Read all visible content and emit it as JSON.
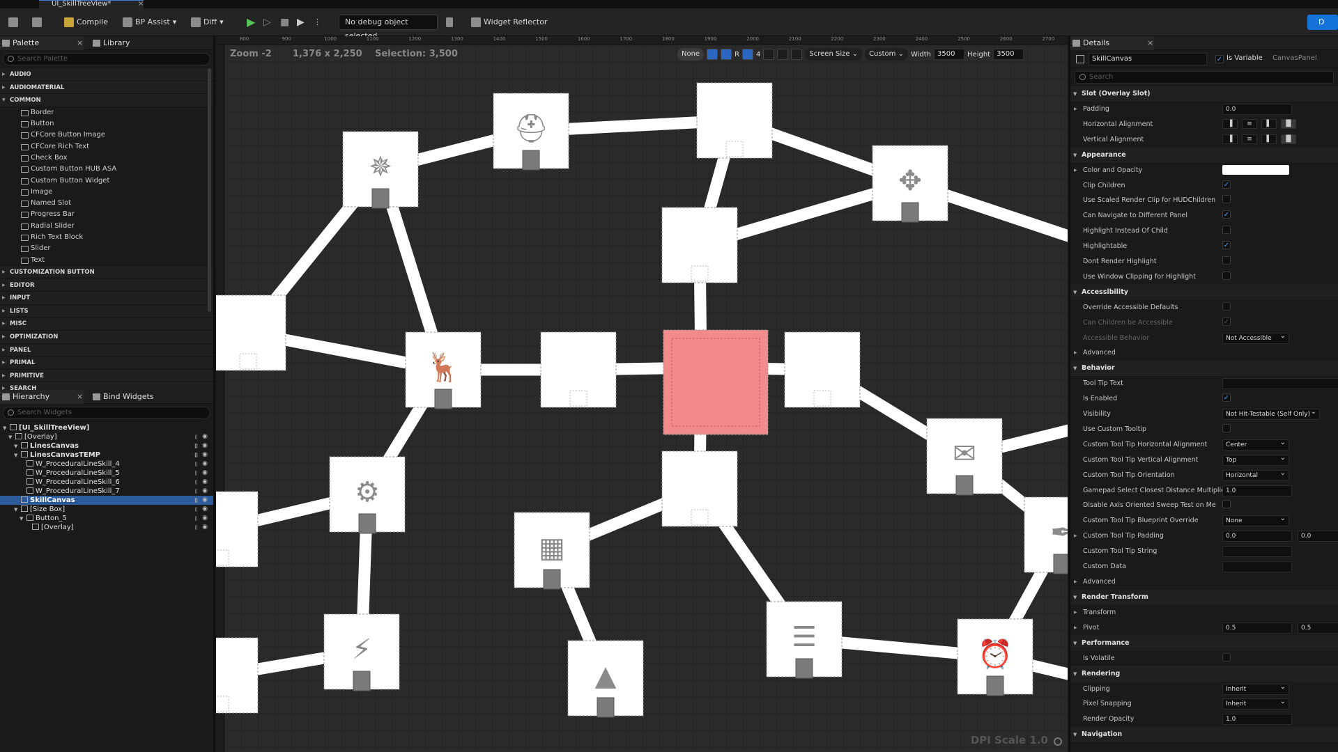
{
  "window": {
    "doc_tab": "UI_SkillTreeView*",
    "close_glyph": "×",
    "right_button": "D"
  },
  "toolbar": {
    "compile": "Compile",
    "bp_assist": "BP Assist",
    "diff": "Diff",
    "debug_select": "No debug object selected",
    "widget_reflector": "Widget Reflector"
  },
  "palette": {
    "tab": "Palette",
    "library_tab": "Library",
    "search_placeholder": "Search Palette",
    "categories_before": [
      "AUDIO",
      "AUDIOMATERIAL"
    ],
    "common_label": "COMMON",
    "common_items": [
      "Border",
      "Button",
      "CFCore Button Image",
      "CFCore Rich Text",
      "Check Box",
      "Custom Button HUB ASA",
      "Custom Button Widget",
      "Image",
      "Named Slot",
      "Progress Bar",
      "Radial Slider",
      "Rich Text Block",
      "Slider",
      "Text"
    ],
    "categories_after": [
      "CUSTOMIZATION BUTTON",
      "EDITOR",
      "INPUT",
      "LISTS",
      "MISC",
      "OPTIMIZATION",
      "PANEL",
      "PRIMAL",
      "PRIMITIVE",
      "SEARCH"
    ]
  },
  "hierarchy": {
    "tab": "Hierarchy",
    "bind_tab": "Bind Widgets",
    "search_placeholder": "Search Widgets",
    "nodes": [
      {
        "label": "[UI_SkillTreeView]",
        "depth": 0,
        "bold": true
      },
      {
        "label": "[Overlay]",
        "depth": 1,
        "bold": false
      },
      {
        "label": "LinesCanvas",
        "depth": 2,
        "bold": true
      },
      {
        "label": "LinesCanvasTEMP",
        "depth": 2,
        "bold": true
      },
      {
        "label": "W_ProceduralLineSkill_4",
        "depth": 3,
        "bold": false
      },
      {
        "label": "W_ProceduralLineSkill_5",
        "depth": 3,
        "bold": false
      },
      {
        "label": "W_ProceduralLineSkill_6",
        "depth": 3,
        "bold": false
      },
      {
        "label": "W_ProceduralLineSkill_7",
        "depth": 3,
        "bold": false
      },
      {
        "label": "SkillCanvas",
        "depth": 2,
        "bold": true,
        "selected": true
      },
      {
        "label": "[Size Box]",
        "depth": 2,
        "bold": false
      },
      {
        "label": "Button_5",
        "depth": 3,
        "bold": false
      },
      {
        "label": "[Overlay]",
        "depth": 4,
        "bold": false
      }
    ]
  },
  "canvas": {
    "zoom": "Zoom -2",
    "dims": "1,376 x 2,250",
    "selection": "Selection: 3,500",
    "ruler_labels": [
      "800",
      "900",
      "1000",
      "1100",
      "1200",
      "1300",
      "1400",
      "1500",
      "1600",
      "1700",
      "1800",
      "1900",
      "2000",
      "2100",
      "2200",
      "2300",
      "2400",
      "2500",
      "2600",
      "2700"
    ],
    "none_pill": "None",
    "r_label": "R",
    "grid_num": "4",
    "screen_size": "Screen Size",
    "custom": "Custom",
    "width_label": "Width",
    "width_value": "3500",
    "height_label": "Height",
    "height_value": "3500",
    "dpi_scale": "DPI Scale 1.0",
    "colors": {
      "selected_node": "#f28b8b",
      "node": "#ffffff",
      "line": "#ffffff",
      "icon": "#8a8a8a"
    }
  },
  "details": {
    "tab": "Details",
    "widget_name": "SkillCanvas",
    "is_variable": "Is Variable",
    "widget_type": "CanvasPanel",
    "search_placeholder": "Search",
    "sections": [
      {
        "title": "Slot (Overlay Slot)",
        "rows": [
          {
            "label": "Padding",
            "sub": true,
            "type": "input",
            "value": "0.0"
          },
          {
            "label": "Horizontal Alignment",
            "type": "align"
          },
          {
            "label": "Vertical Alignment",
            "type": "align"
          }
        ]
      },
      {
        "title": "Appearance",
        "rows": [
          {
            "label": "Color and Opacity",
            "sub": true,
            "type": "swatch"
          },
          {
            "label": "Clip Children",
            "type": "check",
            "checked": true
          },
          {
            "label": "Use Scaled Render Clip for HUDChildren",
            "type": "check",
            "checked": false
          },
          {
            "label": "Can Navigate to Different Panel",
            "type": "check",
            "checked": true
          },
          {
            "label": "Highlight Instead Of Child",
            "type": "check",
            "checked": false
          },
          {
            "label": "Highlightable",
            "type": "check",
            "checked": true
          },
          {
            "label": "Dont Render Highlight",
            "type": "check",
            "checked": false
          },
          {
            "label": "Use Window Clipping for Highlight",
            "type": "check",
            "checked": false
          }
        ]
      },
      {
        "title": "Accessibility",
        "rows": [
          {
            "label": "Override Accessible Defaults",
            "type": "check",
            "checked": false
          },
          {
            "label": "Can Children be Accessible",
            "type": "check",
            "checked": true,
            "dim": true
          },
          {
            "label": "Accessible Behavior",
            "type": "dd",
            "value": "Not Accessible",
            "dim": true
          },
          {
            "label": "Advanced",
            "sub": true,
            "type": "none"
          }
        ]
      },
      {
        "title": "Behavior",
        "rows": [
          {
            "label": "Tool Tip Text",
            "type": "input-wide",
            "value": ""
          },
          {
            "label": "Is Enabled",
            "type": "check",
            "checked": true
          },
          {
            "label": "Visibility",
            "type": "dd-wide",
            "value": "Not Hit-Testable (Self Only)"
          },
          {
            "label": "Use Custom Tooltip",
            "type": "check",
            "checked": false
          },
          {
            "label": "Custom Tool Tip Horizontal Alignment",
            "type": "dd",
            "value": "Center"
          },
          {
            "label": "Custom Tool Tip Vertical Alignment",
            "type": "dd",
            "value": "Top"
          },
          {
            "label": "Custom Tool Tip Orientation",
            "type": "dd",
            "value": "Horizontal"
          },
          {
            "label": "Gamepad Select Closest Distance Multiplier",
            "type": "input",
            "value": "1.0"
          },
          {
            "label": "Disable Axis Oriented Sweep Test on Me",
            "type": "check",
            "checked": false
          },
          {
            "label": "Custom Tool Tip Blueprint Override",
            "type": "dd",
            "value": "None"
          },
          {
            "label": "Custom Tool Tip Padding",
            "sub": true,
            "type": "input2",
            "value": "0.0",
            "value2": "0.0"
          },
          {
            "label": "Custom Tool Tip String",
            "type": "input",
            "value": ""
          },
          {
            "label": "Custom Data",
            "type": "input",
            "value": ""
          },
          {
            "label": "Advanced",
            "sub": true,
            "type": "none"
          }
        ]
      },
      {
        "title": "Render Transform",
        "rows": [
          {
            "label": "Transform",
            "sub": true,
            "type": "none"
          },
          {
            "label": "Pivot",
            "sub": true,
            "type": "input2",
            "value": "0.5",
            "value2": "0.5"
          }
        ]
      },
      {
        "title": "Performance",
        "rows": [
          {
            "label": "Is Volatile",
            "type": "check",
            "checked": false
          }
        ]
      },
      {
        "title": "Rendering",
        "rows": [
          {
            "label": "Clipping",
            "type": "dd",
            "value": "Inherit"
          },
          {
            "label": "Pixel Snapping",
            "type": "dd",
            "value": "Inherit"
          },
          {
            "label": "Render Opacity",
            "type": "input",
            "value": "1.0"
          }
        ]
      },
      {
        "title": "Navigation",
        "rows": []
      }
    ]
  }
}
